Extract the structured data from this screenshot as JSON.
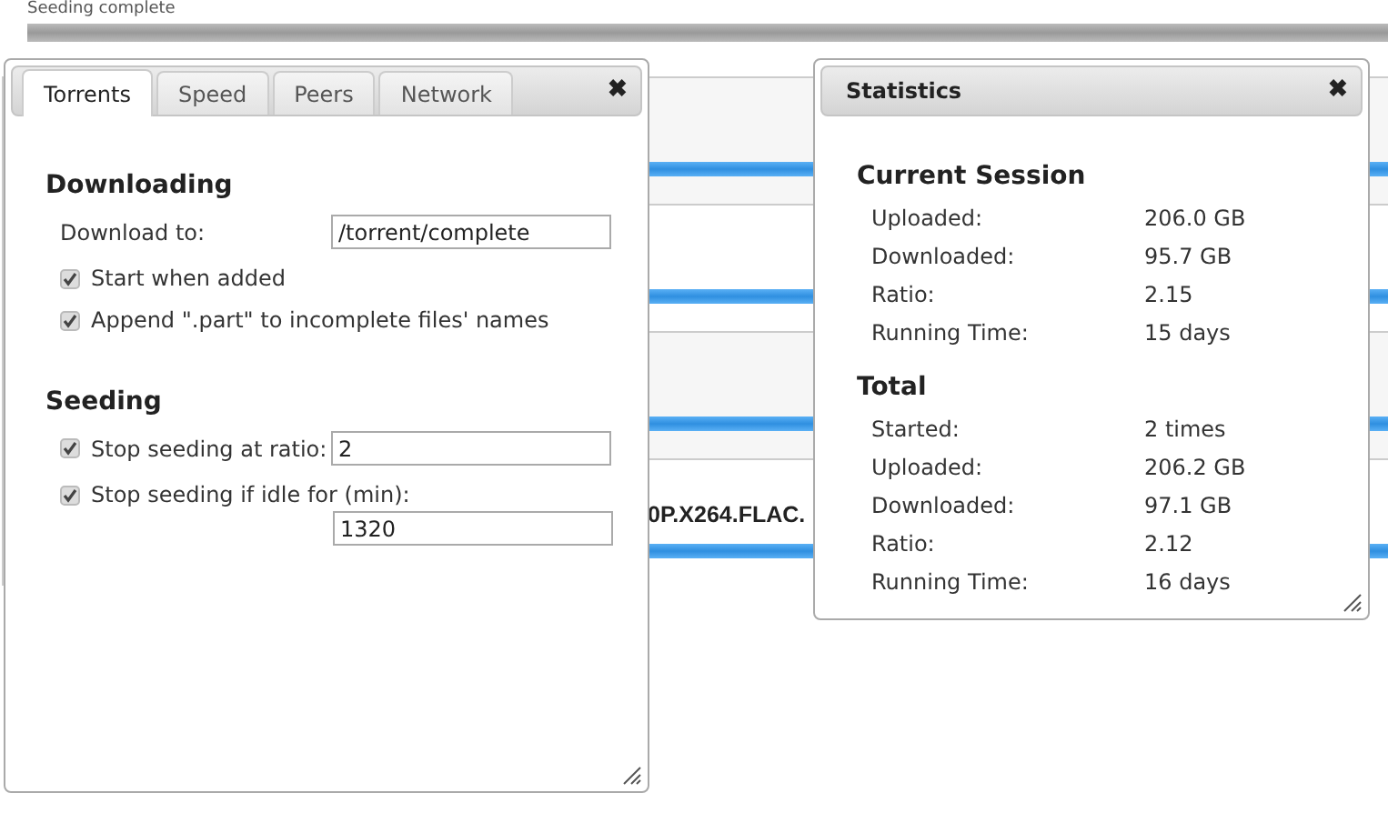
{
  "torrent_list": {
    "top_row": {
      "status": "Seeding complete",
      "level": 1
    },
    "rows": [
      {
        "level": 1
      },
      {
        "level": 1
      },
      {
        "level": 1
      },
      {
        "level": 1,
        "name": "0P.X264.FLAC."
      }
    ]
  },
  "preferences": {
    "tabs": [
      {
        "label": "Torrents",
        "selected": true
      },
      {
        "label": "Speed",
        "selected": false
      },
      {
        "label": "Peers",
        "selected": false
      },
      {
        "label": "Network",
        "selected": false
      }
    ],
    "close": "✖",
    "sections": [
      {
        "heading": "Downloading",
        "items": [
          {
            "kind": "field",
            "label": "Download to:",
            "value": "/torrent/complete"
          },
          {
            "kind": "checkbox",
            "label": "Start when added",
            "checked": true
          },
          {
            "kind": "checkbox",
            "label": "Append \".part\" to incomplete files' names",
            "checked": true
          }
        ]
      },
      {
        "heading": "Seeding",
        "items": [
          {
            "kind": "checkfield",
            "label": "Stop seeding at ratio:",
            "checked": true,
            "value": "2"
          },
          {
            "kind": "checkfield_below",
            "label": "Stop seeding if idle for (min):",
            "checked": true,
            "value": "1320"
          }
        ]
      }
    ]
  },
  "statistics": {
    "title": "Statistics",
    "close": "✖",
    "sections": [
      {
        "heading": "Current Session",
        "rows": [
          {
            "label": "Uploaded:",
            "value": "206.0 GB"
          },
          {
            "label": "Downloaded:",
            "value": "95.7 GB"
          },
          {
            "label": "Ratio:",
            "value": "2.15"
          },
          {
            "label": "Running Time:",
            "value": "15 days"
          }
        ]
      },
      {
        "heading": "Total",
        "rows": [
          {
            "label": "Started:",
            "value": "2 times"
          },
          {
            "label": "Uploaded:",
            "value": "206.2 GB"
          },
          {
            "label": "Downloaded:",
            "value": "97.1 GB"
          },
          {
            "label": "Ratio:",
            "value": "2.12"
          },
          {
            "label": "Running Time:",
            "value": "16 days"
          }
        ]
      }
    ]
  }
}
